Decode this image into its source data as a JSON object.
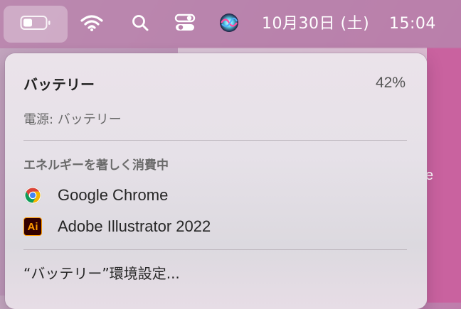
{
  "menubar": {
    "clock_date": "10月30日 (土)",
    "clock_time": "15:04",
    "icons": [
      "battery-icon",
      "wifi-icon",
      "search-icon",
      "control-center-icon",
      "siri-icon"
    ]
  },
  "battery_menu": {
    "title": "バッテリー",
    "percent": "42%",
    "level": 0.42,
    "power_source": "電源: バッテリー",
    "section_heading": "エネルギーを著しく消費中",
    "apps": [
      {
        "name": "Google Chrome",
        "icon": "chrome-icon"
      },
      {
        "name": "Adobe Illustrator 2022",
        "icon": "illustrator-icon",
        "icon_text": "Ai"
      }
    ],
    "settings_label": "“バッテリー”環境設定..."
  },
  "background": {
    "partial_text": "e"
  }
}
